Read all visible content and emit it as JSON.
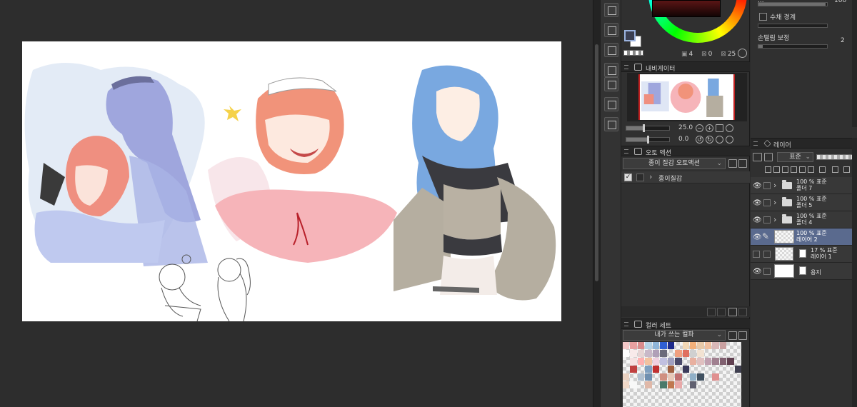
{
  "color_wheel": {
    "main_color": "#3b3f52",
    "sub_color": "#ffffff",
    "readout": [
      {
        "symbol": "▣",
        "value": "4"
      },
      {
        "symbol": "⊠",
        "value": "0"
      },
      {
        "symbol": "⊠",
        "value": "25"
      }
    ]
  },
  "navigator": {
    "title": "내비게이터",
    "zoom": "25.0",
    "rotation": "0.0",
    "zoom_fraction": 0.4,
    "rotation_fraction": 0.5
  },
  "auto_action": {
    "title": "오토 액션",
    "selected_set": "종이 질감 오토액션",
    "items": [
      {
        "label": "종이질감",
        "checked": true
      }
    ]
  },
  "color_set": {
    "title": "컬러 세트",
    "selected_set": "내가 쓰는 컬파",
    "swatches": [
      "#f2c7c7",
      "#e8a0a0",
      "#d98c8c",
      "#b5d3e6",
      "#8fb6d9",
      "#2f5fd4",
      "#1c2a8c",
      "",
      "#f3d8b5",
      "#f2b07a",
      "#e7c9a9",
      "#f0c0a0",
      "#d9b8b8",
      "#c9a0a0",
      "",
      "",
      "#ffffff",
      "#f8eaea",
      "#e6d4d4",
      "#c8b8c8",
      "#b0a0b8",
      "#6b6b7b",
      "",
      "#f0a080",
      "#e07060",
      "#d0d0d0",
      "#f2e2d2",
      "",
      "",
      "",
      "",
      "",
      "",
      "#f5e1e1",
      "#ffb0b0",
      "#f2c2a0",
      "#f0d0e0",
      "#c0c0e0",
      "#a0a0c0",
      "#4a4a6a",
      "",
      "#e8b0a0",
      "#e0c0c0",
      "#c0a0b0",
      "#a08090",
      "#806070",
      "#604050",
      "",
      "",
      "#c04040",
      "",
      "#80a0c0",
      "#c03030",
      "",
      "#a06040",
      "",
      "#3a3a5a",
      "",
      "",
      "",
      "",
      "",
      "",
      "#404050",
      "#e8d0c0",
      "",
      "#b0c0d0",
      "#7090b0",
      "",
      "#d09080",
      "#e8c8b8",
      "#c07070",
      "",
      "#90b0c8",
      "#405060",
      "",
      "#e09090",
      "",
      "",
      "",
      "#f0d8c8",
      "#f8f8f8",
      "",
      "#e0b8a8",
      "",
      "#4a7a6a",
      "#c07850",
      "#e8a8a8",
      "",
      "#606070",
      "",
      "",
      "",
      "",
      "",
      ""
    ]
  },
  "tool_property": {
    "opacity_label": "...",
    "opacity_value": "100",
    "watercolor_edge_label": "수채 경계",
    "stabilization_label": "손떨림 보정",
    "stabilization_value": "2"
  },
  "layers": {
    "title": "레이어",
    "blend_mode": "표준",
    "items": [
      {
        "line1": "100 % 표준",
        "line2": "폴더 7",
        "type": "folder",
        "visible": true,
        "selected": false
      },
      {
        "line1": "100 % 표준",
        "line2": "폴더 5",
        "type": "folder",
        "visible": true,
        "selected": false
      },
      {
        "line1": "100 % 표준",
        "line2": "폴더 4",
        "type": "folder",
        "visible": true,
        "selected": false
      },
      {
        "line1": "100 % 표준",
        "line2": "레이어 2",
        "type": "raster",
        "visible": true,
        "selected": true
      },
      {
        "line1": "17 % 표준",
        "line2": "레이어 1",
        "type": "raster-indent",
        "visible": false,
        "selected": false
      },
      {
        "line1": "",
        "line2": "용지",
        "type": "paper",
        "visible": true,
        "selected": false
      }
    ]
  }
}
